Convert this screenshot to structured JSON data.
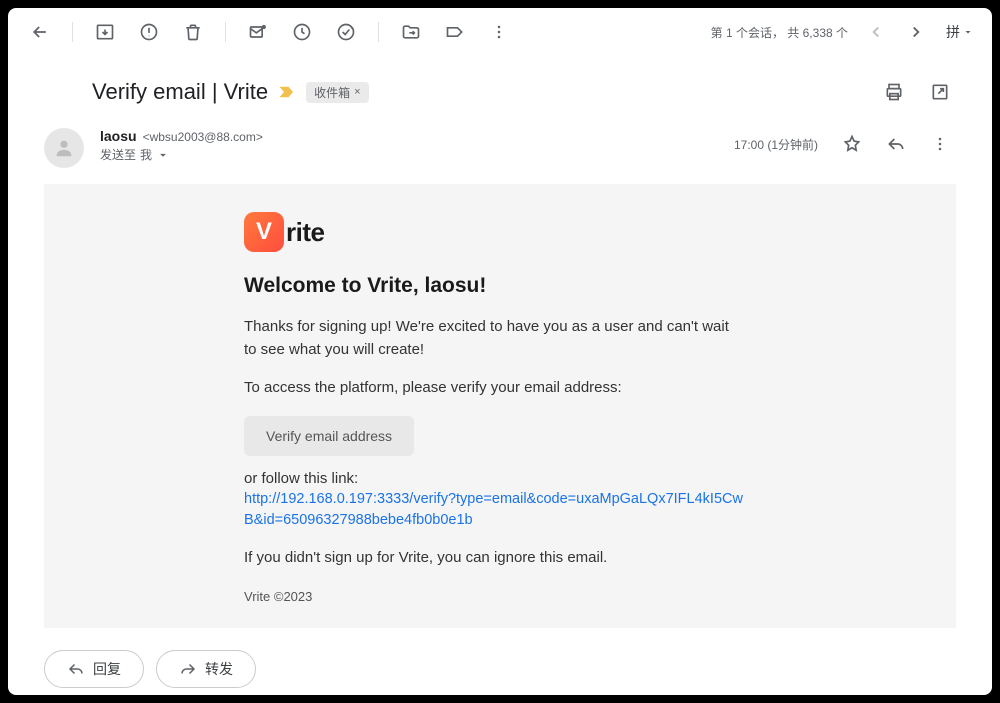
{
  "toolbar": {
    "conversation_position": "第 1 个会话，",
    "total_count": "共 6,338 个",
    "ime_label": "拼"
  },
  "subject": {
    "text": "Verify email | Vrite",
    "label_chip": "收件箱"
  },
  "sender": {
    "name": "laosu",
    "email": "<wbsu2003@88.com>",
    "recipient_prefix": "发送至",
    "recipient": "我"
  },
  "meta": {
    "timestamp": "17:00 (1分钟前)"
  },
  "email": {
    "logo_letter": "V",
    "logo_text": "rite",
    "welcome": "Welcome to Vrite, laosu!",
    "p1": "Thanks for signing up! We're excited to have you as a user and can't wait to see what you will create!",
    "p2": "To access the platform, please verify your email address:",
    "verify_button": "Verify email address",
    "p3": "or follow this link:",
    "link": "http://192.168.0.197:3333/verify?type=email&code=uxaMpGaLQx7IFL4kI5CwB&id=65096327988bebe4fb0b0e1b",
    "p4": "If you didn't sign up for Vrite, you can ignore this email.",
    "signature": "Vrite ©2023"
  },
  "actions": {
    "reply": "回复",
    "forward": "转发"
  }
}
